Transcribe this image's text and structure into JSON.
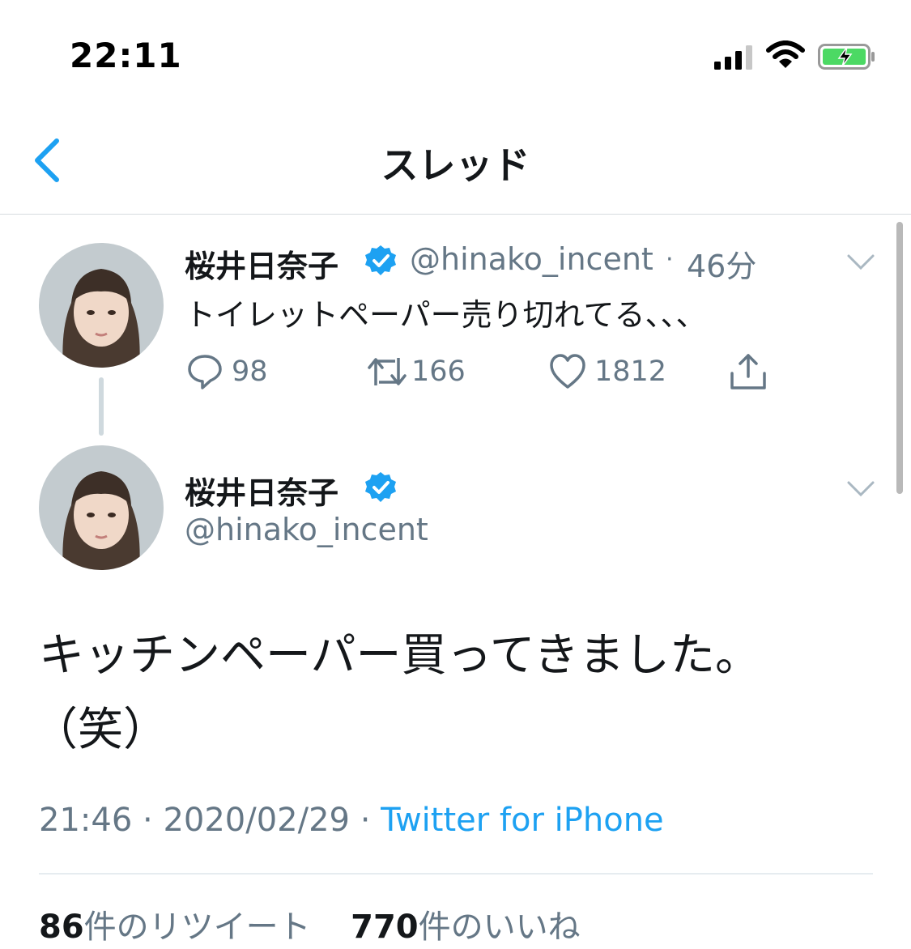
{
  "status_bar": {
    "time": "22:11"
  },
  "nav": {
    "title": "スレッド",
    "back_icon": "chevron-left-icon"
  },
  "tweet1": {
    "name": "桜井日奈子",
    "handle": "@hinako_incent",
    "separator": "·",
    "time_ago": "46分",
    "text": "トイレットペーパー売り切れてる、、、",
    "replies": "98",
    "retweets": "166",
    "likes": "1812"
  },
  "tweet2": {
    "name": "桜井日奈子",
    "handle": "@hinako_incent",
    "text_line1": "キッチンペーパー買ってきました。",
    "text_line2": "（笑）",
    "time": "21:46",
    "dot1": "·",
    "date": "2020/02/29",
    "dot2": "·",
    "source": "Twitter for iPhone",
    "retweet_count": "86",
    "retweet_label": "件のリツイート",
    "like_count": "770",
    "like_label": "件のいいね"
  },
  "colors": {
    "accent": "#1da1f2",
    "secondary_text": "#657786",
    "primary_text": "#14171a"
  }
}
